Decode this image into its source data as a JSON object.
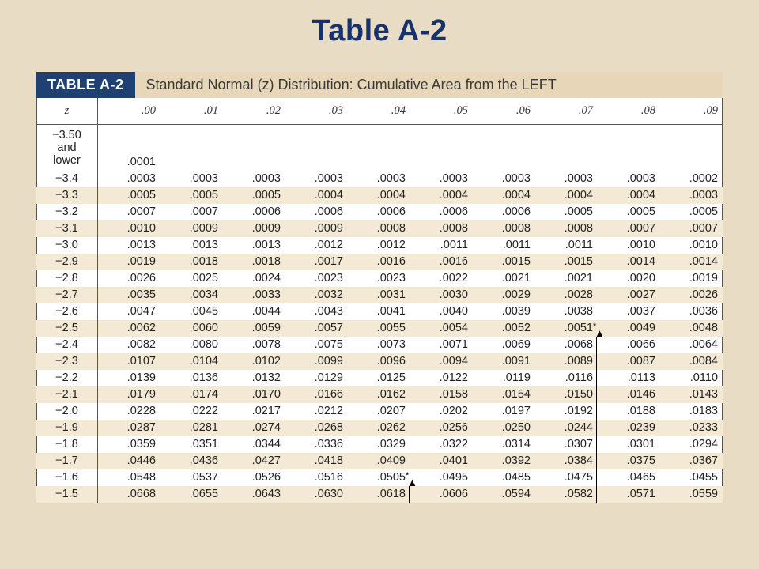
{
  "page_title": "Table A-2",
  "banner": {
    "badge": "TABLE A-2",
    "desc": "Standard Normal (z) Distribution: Cumulative Area from the LEFT"
  },
  "headers": [
    "z",
    ".00",
    ".01",
    ".02",
    ".03",
    ".04",
    ".05",
    ".06",
    ".07",
    ".08",
    ".09"
  ],
  "special_row": {
    "z_label_lines": [
      "−3.50",
      "and",
      "lower"
    ],
    "value": ".0001"
  },
  "chart_data": {
    "type": "table",
    "title": "Standard Normal (z) Distribution: Cumulative Area from the LEFT",
    "col_increments": [
      ".00",
      ".01",
      ".02",
      ".03",
      ".04",
      ".05",
      ".06",
      ".07",
      ".08",
      ".09"
    ],
    "rows": [
      {
        "z": "−3.4",
        "vals": [
          ".0003",
          ".0003",
          ".0003",
          ".0003",
          ".0003",
          ".0003",
          ".0003",
          ".0003",
          ".0003",
          ".0002"
        ]
      },
      {
        "z": "−3.3",
        "vals": [
          ".0005",
          ".0005",
          ".0005",
          ".0004",
          ".0004",
          ".0004",
          ".0004",
          ".0004",
          ".0004",
          ".0003"
        ]
      },
      {
        "z": "−3.2",
        "vals": [
          ".0007",
          ".0007",
          ".0006",
          ".0006",
          ".0006",
          ".0006",
          ".0006",
          ".0005",
          ".0005",
          ".0005"
        ]
      },
      {
        "z": "−3.1",
        "vals": [
          ".0010",
          ".0009",
          ".0009",
          ".0009",
          ".0008",
          ".0008",
          ".0008",
          ".0008",
          ".0007",
          ".0007"
        ]
      },
      {
        "z": "−3.0",
        "vals": [
          ".0013",
          ".0013",
          ".0013",
          ".0012",
          ".0012",
          ".0011",
          ".0011",
          ".0011",
          ".0010",
          ".0010"
        ]
      },
      {
        "z": "−2.9",
        "vals": [
          ".0019",
          ".0018",
          ".0018",
          ".0017",
          ".0016",
          ".0016",
          ".0015",
          ".0015",
          ".0014",
          ".0014"
        ]
      },
      {
        "z": "−2.8",
        "vals": [
          ".0026",
          ".0025",
          ".0024",
          ".0023",
          ".0023",
          ".0022",
          ".0021",
          ".0021",
          ".0020",
          ".0019"
        ]
      },
      {
        "z": "−2.7",
        "vals": [
          ".0035",
          ".0034",
          ".0033",
          ".0032",
          ".0031",
          ".0030",
          ".0029",
          ".0028",
          ".0027",
          ".0026"
        ]
      },
      {
        "z": "−2.6",
        "vals": [
          ".0047",
          ".0045",
          ".0044",
          ".0043",
          ".0041",
          ".0040",
          ".0039",
          ".0038",
          ".0037",
          ".0036"
        ]
      },
      {
        "z": "−2.5",
        "vals": [
          ".0062",
          ".0060",
          ".0059",
          ".0057",
          ".0055",
          ".0054",
          ".0052",
          ".0051",
          ".0049",
          ".0048"
        ],
        "markers": [
          {
            "col": 8,
            "star": true,
            "arrow_head": true
          }
        ]
      },
      {
        "z": "−2.4",
        "vals": [
          ".0082",
          ".0080",
          ".0078",
          ".0075",
          ".0073",
          ".0071",
          ".0069",
          ".0068",
          ".0066",
          ".0064"
        ],
        "stems": [
          {
            "col": 8
          }
        ]
      },
      {
        "z": "−2.3",
        "vals": [
          ".0107",
          ".0104",
          ".0102",
          ".0099",
          ".0096",
          ".0094",
          ".0091",
          ".0089",
          ".0087",
          ".0084"
        ],
        "stems": [
          {
            "col": 8
          }
        ]
      },
      {
        "z": "−2.2",
        "vals": [
          ".0139",
          ".0136",
          ".0132",
          ".0129",
          ".0125",
          ".0122",
          ".0119",
          ".0116",
          ".0113",
          ".0110"
        ],
        "stems": [
          {
            "col": 8
          }
        ]
      },
      {
        "z": "−2.1",
        "vals": [
          ".0179",
          ".0174",
          ".0170",
          ".0166",
          ".0162",
          ".0158",
          ".0154",
          ".0150",
          ".0146",
          ".0143"
        ],
        "stems": [
          {
            "col": 8
          }
        ]
      },
      {
        "z": "−2.0",
        "vals": [
          ".0228",
          ".0222",
          ".0217",
          ".0212",
          ".0207",
          ".0202",
          ".0197",
          ".0192",
          ".0188",
          ".0183"
        ],
        "stems": [
          {
            "col": 8
          }
        ]
      },
      {
        "z": "−1.9",
        "vals": [
          ".0287",
          ".0281",
          ".0274",
          ".0268",
          ".0262",
          ".0256",
          ".0250",
          ".0244",
          ".0239",
          ".0233"
        ],
        "stems": [
          {
            "col": 8
          }
        ]
      },
      {
        "z": "−1.8",
        "vals": [
          ".0359",
          ".0351",
          ".0344",
          ".0336",
          ".0329",
          ".0322",
          ".0314",
          ".0307",
          ".0301",
          ".0294"
        ],
        "stems": [
          {
            "col": 8
          }
        ]
      },
      {
        "z": "−1.7",
        "vals": [
          ".0446",
          ".0436",
          ".0427",
          ".0418",
          ".0409",
          ".0401",
          ".0392",
          ".0384",
          ".0375",
          ".0367"
        ],
        "stems": [
          {
            "col": 8
          }
        ]
      },
      {
        "z": "−1.6",
        "vals": [
          ".0548",
          ".0537",
          ".0526",
          ".0516",
          ".0505",
          ".0495",
          ".0485",
          ".0475",
          ".0465",
          ".0455"
        ],
        "markers": [
          {
            "col": 5,
            "star": true,
            "arrow_head": true
          }
        ],
        "stems": [
          {
            "col": 8
          }
        ]
      },
      {
        "z": "−1.5",
        "vals": [
          ".0668",
          ".0655",
          ".0643",
          ".0630",
          ".0618",
          ".0606",
          ".0594",
          ".0582",
          ".0571",
          ".0559"
        ],
        "stems": [
          {
            "col": 5
          },
          {
            "col": 8
          }
        ]
      }
    ]
  }
}
